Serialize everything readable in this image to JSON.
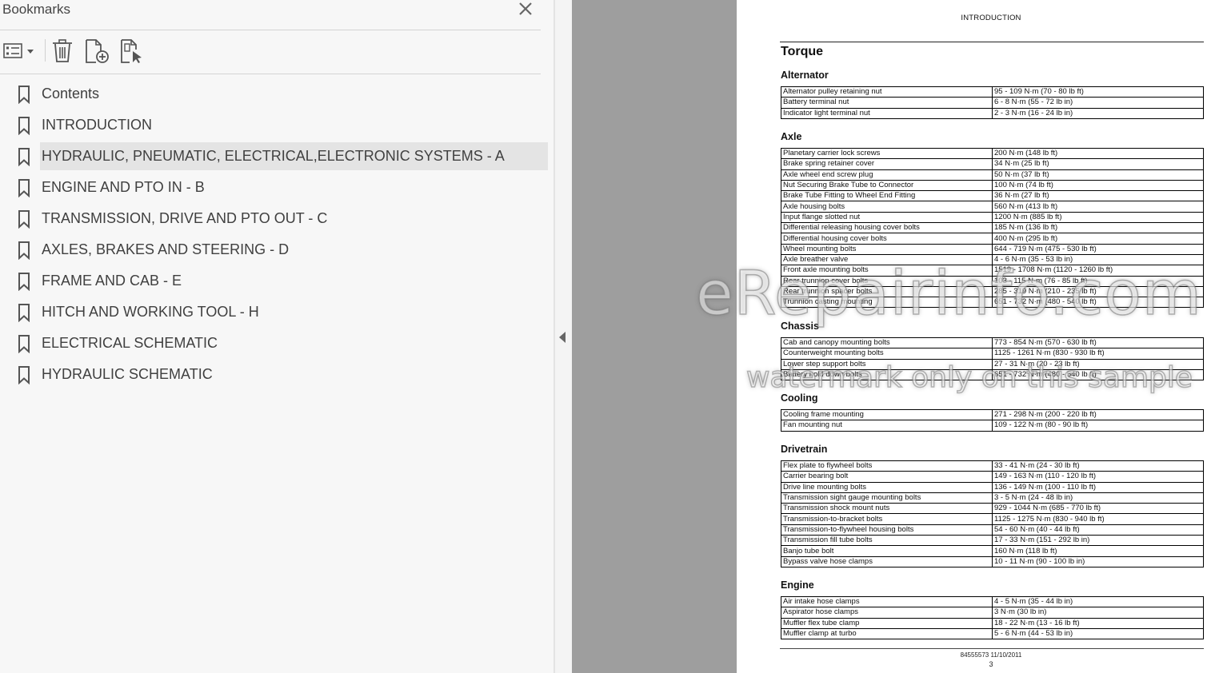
{
  "bookmarks_panel": {
    "title": "Bookmarks",
    "close_icon": "close-icon",
    "toolbar": {
      "options_icon": "bookmark-options-icon",
      "delete_icon": "trash-icon",
      "new_bookmark_icon": "add-bookmark-icon",
      "find_bookmark_icon": "find-current-bookmark-icon"
    },
    "selected_index": 2,
    "items": [
      {
        "label": "Contents"
      },
      {
        "label": "INTRODUCTION"
      },
      {
        "label": "HYDRAULIC, PNEUMATIC, ELECTRICAL,ELECTRONIC SYSTEMS - A"
      },
      {
        "label": "ENGINE AND PTO IN - B"
      },
      {
        "label": "TRANSMISSION, DRIVE AND PTO OUT - C"
      },
      {
        "label": "AXLES, BRAKES AND STEERING - D"
      },
      {
        "label": "FRAME AND CAB - E"
      },
      {
        "label": "HITCH AND WORKING TOOL - H"
      },
      {
        "label": "ELECTRICAL SCHEMATIC"
      },
      {
        "label": "HYDRAULIC SCHEMATIC"
      }
    ]
  },
  "document": {
    "header": "INTRODUCTION",
    "title": "Torque",
    "sections": [
      {
        "heading": "Alternator",
        "rows": [
          [
            "Alternator pulley retaining nut",
            "95 - 109 N·m (70 - 80 lb ft)"
          ],
          [
            "Battery terminal nut",
            "6 - 8 N·m (55 - 72 lb in)"
          ],
          [
            "Indicator light terminal nut",
            "2 - 3 N·m (16 - 24 lb in)"
          ]
        ]
      },
      {
        "heading": "Axle",
        "rows": [
          [
            "Planetary carrier lock screws",
            "200 N·m (148 lb ft)"
          ],
          [
            "Brake spring retainer cover",
            "34 N·m (25 lb ft)"
          ],
          [
            "Axle wheel end screw plug",
            "50 N·m (37 lb ft)"
          ],
          [
            "Nut Securing Brake Tube to Connector",
            "100 N·m (74 lb ft)"
          ],
          [
            "Brake Tube Fitting to Wheel End Fitting",
            "36 N·m (27 lb ft)"
          ],
          [
            "Axle housing bolts",
            "560 N·m (413 lb ft)"
          ],
          [
            "Input flange slotted nut",
            "1200 N·m (885 lb ft)"
          ],
          [
            "Differential releasing housing cover bolts",
            "185 N·m (136 lb ft)"
          ],
          [
            "Differential housing cover bolts",
            "400 N·m (295 lb ft)"
          ],
          [
            "Wheel mounting bolts",
            "644 - 719 N·m (475 - 530 lb ft)"
          ],
          [
            "Axle breather valve",
            "4 - 6 N·m (35 - 53 lb in)"
          ],
          [
            "Front axle mounting bolts",
            "1519 - 1708 N·m (1120 - 1260 lb ft)"
          ],
          [
            "Rear trunnion cover bolts",
            "103 - 115 N·m (76 - 85 lb ft)"
          ],
          [
            "Rear trunnion spacer bolts",
            "285 - 319 N·m (210 - 235 lb ft)"
          ],
          [
            "Trunnion casting mounting",
            "651 - 732 N·m (480 - 540 lb ft)"
          ]
        ]
      },
      {
        "heading": "Chassis",
        "rows": [
          [
            "Cab and canopy mounting bolts",
            "773 - 854 N·m (570 - 630 lb ft)"
          ],
          [
            "Counterweight mounting bolts",
            "1125 - 1261 N·m (830 - 930 lb ft)"
          ],
          [
            "Lower step support bolts",
            "27 - 31 N·m (20 - 23 lb ft)"
          ],
          [
            "Battery hold down bolts",
            "651 - 732 N·m (480 - 540 lb ft)"
          ]
        ]
      },
      {
        "heading": "Cooling",
        "rows": [
          [
            "Cooling frame mounting",
            "271 - 298 N·m (200 - 220 lb ft)"
          ],
          [
            "Fan mounting nut",
            "109 - 122 N·m (80 - 90 lb ft)"
          ]
        ]
      },
      {
        "heading": "Drivetrain",
        "rows": [
          [
            "Flex plate to flywheel bolts",
            "33 - 41 N·m (24 - 30 lb ft)"
          ],
          [
            "Carrier bearing bolt",
            "149 - 163 N·m (110 - 120 lb ft)"
          ],
          [
            "Drive line mounting bolts",
            "136 - 149 N·m (100 - 110 lb ft)"
          ],
          [
            "Transmission sight gauge mounting bolts",
            "3 - 5 N·m (24 - 48 lb in)"
          ],
          [
            "Transmission shock mount nuts",
            "929 - 1044 N·m (685 - 770 lb ft)"
          ],
          [
            "Transmission-to-bracket bolts",
            "1125 - 1275 N·m (830 - 940 lb ft)"
          ],
          [
            "Transmission-to-flywheel housing bolts",
            "54 - 60 N·m (40 - 44 lb ft)"
          ],
          [
            "Transmission fill tube bolts",
            "17 - 33 N·m (151 - 292 lb in)"
          ],
          [
            "Banjo tube bolt",
            "160 N·m (118 lb ft)"
          ],
          [
            "Bypass valve hose clamps",
            "10 - 11 N·m (90 - 100 lb in)"
          ]
        ]
      },
      {
        "heading": "Engine",
        "rows": [
          [
            "Air intake hose clamps",
            "4 - 5 N·m (35 - 44 lb in)"
          ],
          [
            "Aspirator hose clamps",
            "3 N·m (30 lb in)"
          ],
          [
            "Muffler flex tube clamp",
            "18 - 22 N·m (13 - 16 lb ft)"
          ],
          [
            "Muffler clamp at turbo",
            "5 - 6 N·m (44 - 53 lb in)"
          ]
        ]
      }
    ],
    "footer_doc_id": "84555573 11/10/2011",
    "page_number": "3"
  },
  "watermark": {
    "line1": "eRepairinfo.com",
    "line2": "watermark only on this sample"
  },
  "colors": {
    "panel_bg": "#f7f7f7",
    "selected_bg": "#e4e4e4",
    "viewer_bg": "#9e9e9e",
    "icon_gray": "#555555"
  }
}
